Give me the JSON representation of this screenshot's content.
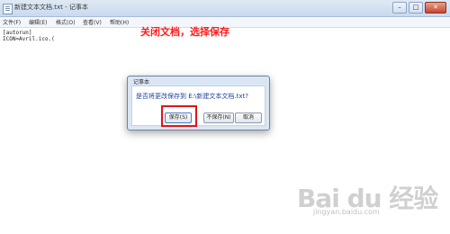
{
  "window": {
    "title": "新建文本文档.txt - 记事本",
    "controls": {
      "minimize": "–",
      "maximize": "□",
      "close": "✕"
    }
  },
  "menu": {
    "items": [
      {
        "label": "文件(F)"
      },
      {
        "label": "编辑(E)"
      },
      {
        "label": "格式(O)"
      },
      {
        "label": "查看(V)"
      },
      {
        "label": "帮助(H)"
      }
    ]
  },
  "editor": {
    "lines": [
      "[autorun]",
      "ICON=Avril.ico.("
    ]
  },
  "annotation": "关闭文档，选择保存",
  "dialog": {
    "title": "记事本",
    "message": "是否将更改保存到 E:\\新建文本文档.txt?",
    "buttons": {
      "save": "保存(S)",
      "dont_save": "不保存(N)",
      "cancel": "取消"
    },
    "highlighted_button": "save"
  },
  "watermark": {
    "logo": "Bai du 经验",
    "url": "jingyan.baidu.com"
  },
  "colors": {
    "annotation": "#ff1b1b",
    "highlight": "#e0141b",
    "dialog_background": "#dbe6f4"
  }
}
